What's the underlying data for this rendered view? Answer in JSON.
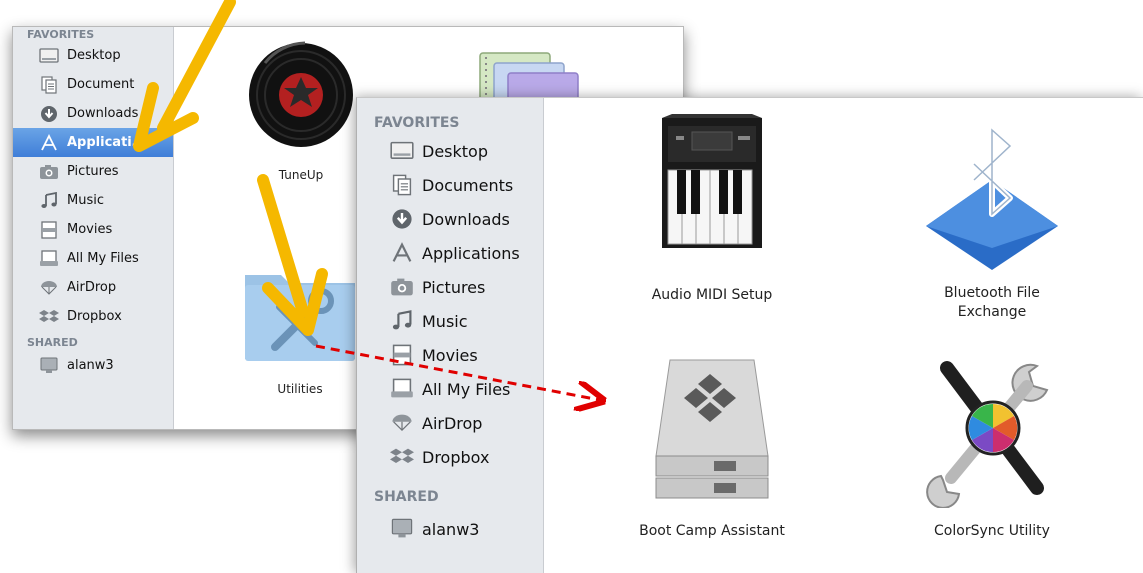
{
  "back_window": {
    "sidebar": {
      "favorites_header": "FAVORITES",
      "items": [
        {
          "label": "Desktop",
          "icon": "desktop-icon"
        },
        {
          "label": "Document",
          "icon": "documents-icon"
        },
        {
          "label": "Downloads",
          "icon": "downloads-icon"
        },
        {
          "label": "Applicati…",
          "icon": "applications-icon",
          "selected": true
        },
        {
          "label": "Pictures",
          "icon": "pictures-icon"
        },
        {
          "label": "Music",
          "icon": "music-icon"
        },
        {
          "label": "Movies",
          "icon": "movies-icon"
        },
        {
          "label": "All My Files",
          "icon": "all-my-files-icon"
        },
        {
          "label": "AirDrop",
          "icon": "airdrop-icon"
        },
        {
          "label": "Dropbox",
          "icon": "dropbox-icon"
        }
      ],
      "shared_header": "SHARED",
      "shared_items": [
        {
          "label": "alanw3",
          "icon": "computer-icon"
        }
      ]
    },
    "files": [
      {
        "label": "TuneUp",
        "icon": "tuneup-record-icon"
      },
      {
        "label": "Utilities",
        "icon": "utilities-folder-icon"
      },
      {
        "label": "",
        "icon": "notebook-app-icon"
      }
    ]
  },
  "front_window": {
    "sidebar": {
      "favorites_header": "FAVORITES",
      "items": [
        {
          "label": "Desktop",
          "icon": "desktop-icon"
        },
        {
          "label": "Documents",
          "icon": "documents-icon"
        },
        {
          "label": "Downloads",
          "icon": "downloads-icon"
        },
        {
          "label": "Applications",
          "icon": "applications-icon"
        },
        {
          "label": "Pictures",
          "icon": "pictures-icon"
        },
        {
          "label": "Music",
          "icon": "music-icon"
        },
        {
          "label": "Movies",
          "icon": "movies-icon"
        },
        {
          "label": "All My Files",
          "icon": "all-my-files-icon"
        },
        {
          "label": "AirDrop",
          "icon": "airdrop-icon"
        },
        {
          "label": "Dropbox",
          "icon": "dropbox-icon"
        }
      ],
      "shared_header": "SHARED",
      "shared_items": [
        {
          "label": "alanw3",
          "icon": "computer-icon"
        }
      ]
    },
    "files": [
      {
        "label": "Audio MIDI Setup",
        "icon": "piano-keyboard-icon"
      },
      {
        "label": "Bluetooth File Exchange",
        "icon": "bluetooth-icon"
      },
      {
        "label": "Boot Camp Assistant",
        "icon": "boot-camp-drive-icon"
      },
      {
        "label": "ColorSync Utility",
        "icon": "colorsync-tools-icon"
      }
    ]
  },
  "annotations": {
    "arrow_color": "#f5b800",
    "dashed_arrow_color": "#e00000"
  }
}
